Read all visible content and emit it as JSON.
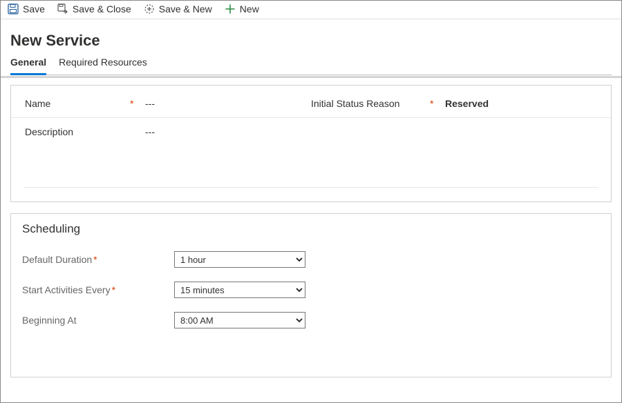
{
  "toolbar": {
    "save": "Save",
    "save_close": "Save & Close",
    "save_new": "Save & New",
    "new": "New"
  },
  "header": {
    "title": "New Service",
    "tabs": {
      "general": "General",
      "required_resources": "Required Resources"
    }
  },
  "details": {
    "name_label": "Name",
    "name_value": "---",
    "description_label": "Description",
    "description_value": "---",
    "status_label": "Initial Status Reason",
    "status_value": "Reserved"
  },
  "scheduling": {
    "title": "Scheduling",
    "default_duration_label": "Default Duration",
    "default_duration_value": "1 hour",
    "start_every_label": "Start Activities Every",
    "start_every_value": "15 minutes",
    "beginning_at_label": "Beginning At",
    "beginning_at_value": "8:00 AM"
  }
}
